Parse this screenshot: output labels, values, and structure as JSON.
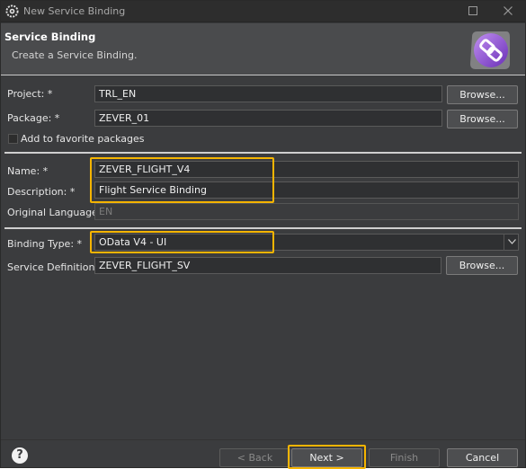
{
  "window": {
    "title": "New Service Binding"
  },
  "header": {
    "title": "Service Binding",
    "description": "Create a Service Binding."
  },
  "form": {
    "project_label": "Project: *",
    "project_value": "TRL_EN",
    "package_label": "Package: *",
    "package_value": "ZEVER_01",
    "browse_label": "Browse...",
    "favorite_label": "Add to favorite packages",
    "name_label": "Name: *",
    "name_value": "ZEVER_FLIGHT_V4",
    "description_label": "Description: *",
    "description_value": "Flight Service Binding",
    "original_language_label": "Original Language:",
    "original_language_value": "EN",
    "binding_type_label": "Binding Type: *",
    "binding_type_value": "OData V4 - UI",
    "service_definition_label": "Service Definition: *",
    "service_definition_value": "ZEVER_FLIGHT_SV"
  },
  "footer": {
    "help_symbol": "?",
    "back_label": "< Back",
    "next_label": "Next >",
    "finish_label": "Finish",
    "cancel_label": "Cancel"
  },
  "colors": {
    "highlight": "#f5b400",
    "background": "#3b3c3e",
    "header_bg": "#4a4b4d"
  }
}
